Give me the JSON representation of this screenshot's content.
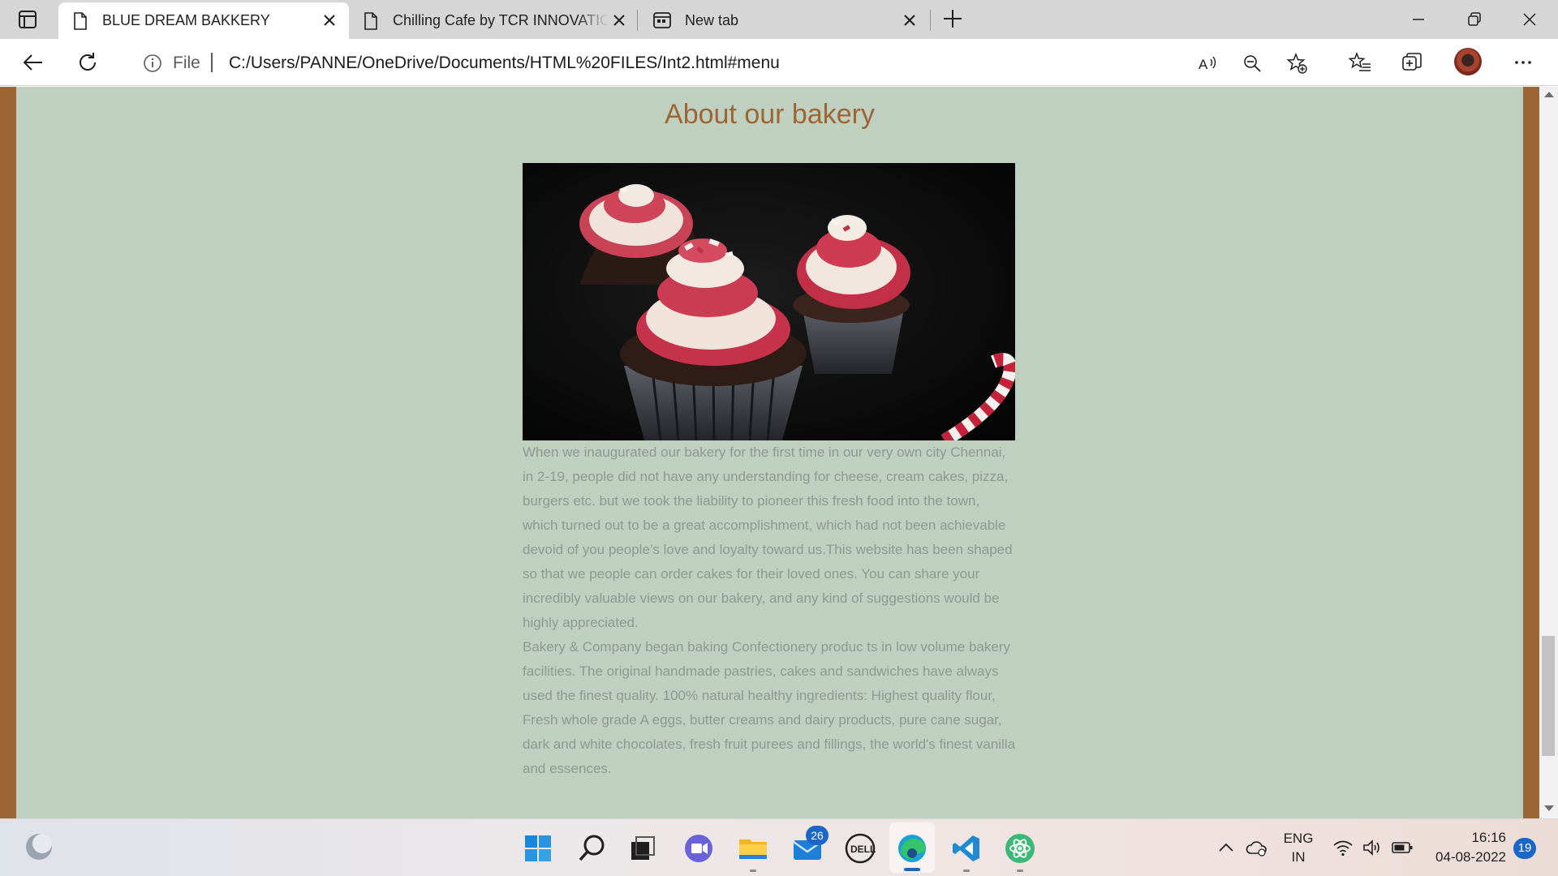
{
  "browser": {
    "tabs": [
      {
        "title": "BLUE DREAM BAKKERY",
        "active": true
      },
      {
        "title": "Chilling Cafe by TCR INNOVATIO",
        "active": false
      },
      {
        "title": "New tab",
        "active": false
      }
    ],
    "address": {
      "scheme_label": "File",
      "url": "C:/Users/PANNE/OneDrive/Documents/HTML%20FILES/Int2.html#menu"
    }
  },
  "page": {
    "heading": "About our bakery",
    "image_icon": "cupcakes-photo",
    "paragraph_1": "When we inaugurated our bakery for the first time in our very own city Chennai, in 2-19, people did not have any understanding for cheese, cream cakes, pizza, burgers etc. but we took the liability to pioneer this fresh food into the town, which turned out to be a great accomplishment, which had not been achievable devoid of you people’s love and loyalty toward us.This website has been shaped so that we people can order cakes for their loved ones. You can share your incredibly valuable views on our bakery, and any kind of suggestions would be highly appreciated.",
    "paragraph_2": "Bakery & Company began baking Confectionery produc ts in low volume bakery facilities. The original handmade pastries, cakes and sandwiches have always used the finest quality. 100% natural healthy ingredients: Highest quality flour, Fresh whole grade A eggs, butter creams and dairy products, pure cane sugar, dark and white chocolates, fresh fruit purees and fillings, the world's finest vanilla and essences.",
    "colors": {
      "frame": "#9b6534",
      "background": "#bfcfc0",
      "heading": "#9b6534",
      "text": "#8d9a8e"
    }
  },
  "taskbar": {
    "mail_badge": "26",
    "language": "ENG",
    "region": "IN",
    "time": "16:16",
    "date": "04-08-2022",
    "notification_count": "19"
  }
}
